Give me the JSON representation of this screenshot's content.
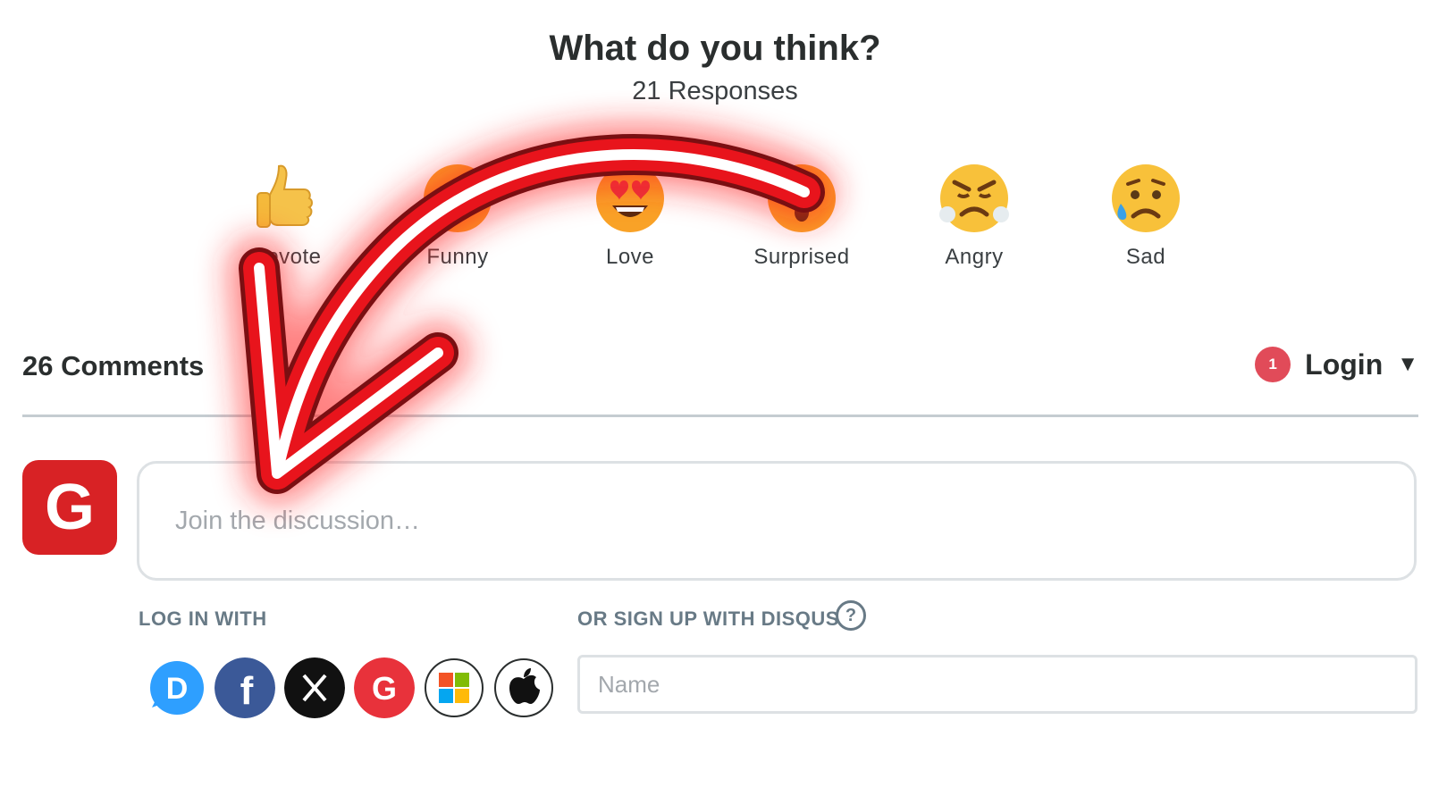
{
  "reactions_panel": {
    "title": "What do you think?",
    "responses": "21 Responses",
    "items": [
      {
        "label": "Upvote",
        "icon": "thumbs-up-icon"
      },
      {
        "label": "Funny",
        "icon": "laughing-face-icon"
      },
      {
        "label": "Love",
        "icon": "heart-eyes-face-icon"
      },
      {
        "label": "Surprised",
        "icon": "surprised-face-icon"
      },
      {
        "label": "Angry",
        "icon": "angry-face-icon"
      },
      {
        "label": "Sad",
        "icon": "sad-face-icon"
      }
    ]
  },
  "comments_bar": {
    "count_label": "26 Comments",
    "notification_count": "1",
    "login_label": "Login",
    "caret": "▼"
  },
  "composer": {
    "avatar_letter": "G",
    "placeholder": "Join the discussion…"
  },
  "login_section": {
    "login_with_label": "LOG IN WITH",
    "signup_label": "OR SIGN UP WITH DISQUS",
    "help_glyph": "?",
    "providers": [
      "Disqus",
      "Facebook",
      "X",
      "Google",
      "Microsoft",
      "Apple"
    ],
    "name_placeholder": "Name"
  },
  "colors": {
    "accent_red": "#e14b59",
    "avatar_red": "#d82225",
    "label_gray": "#687a86",
    "arrow_red": "#e8141c"
  }
}
